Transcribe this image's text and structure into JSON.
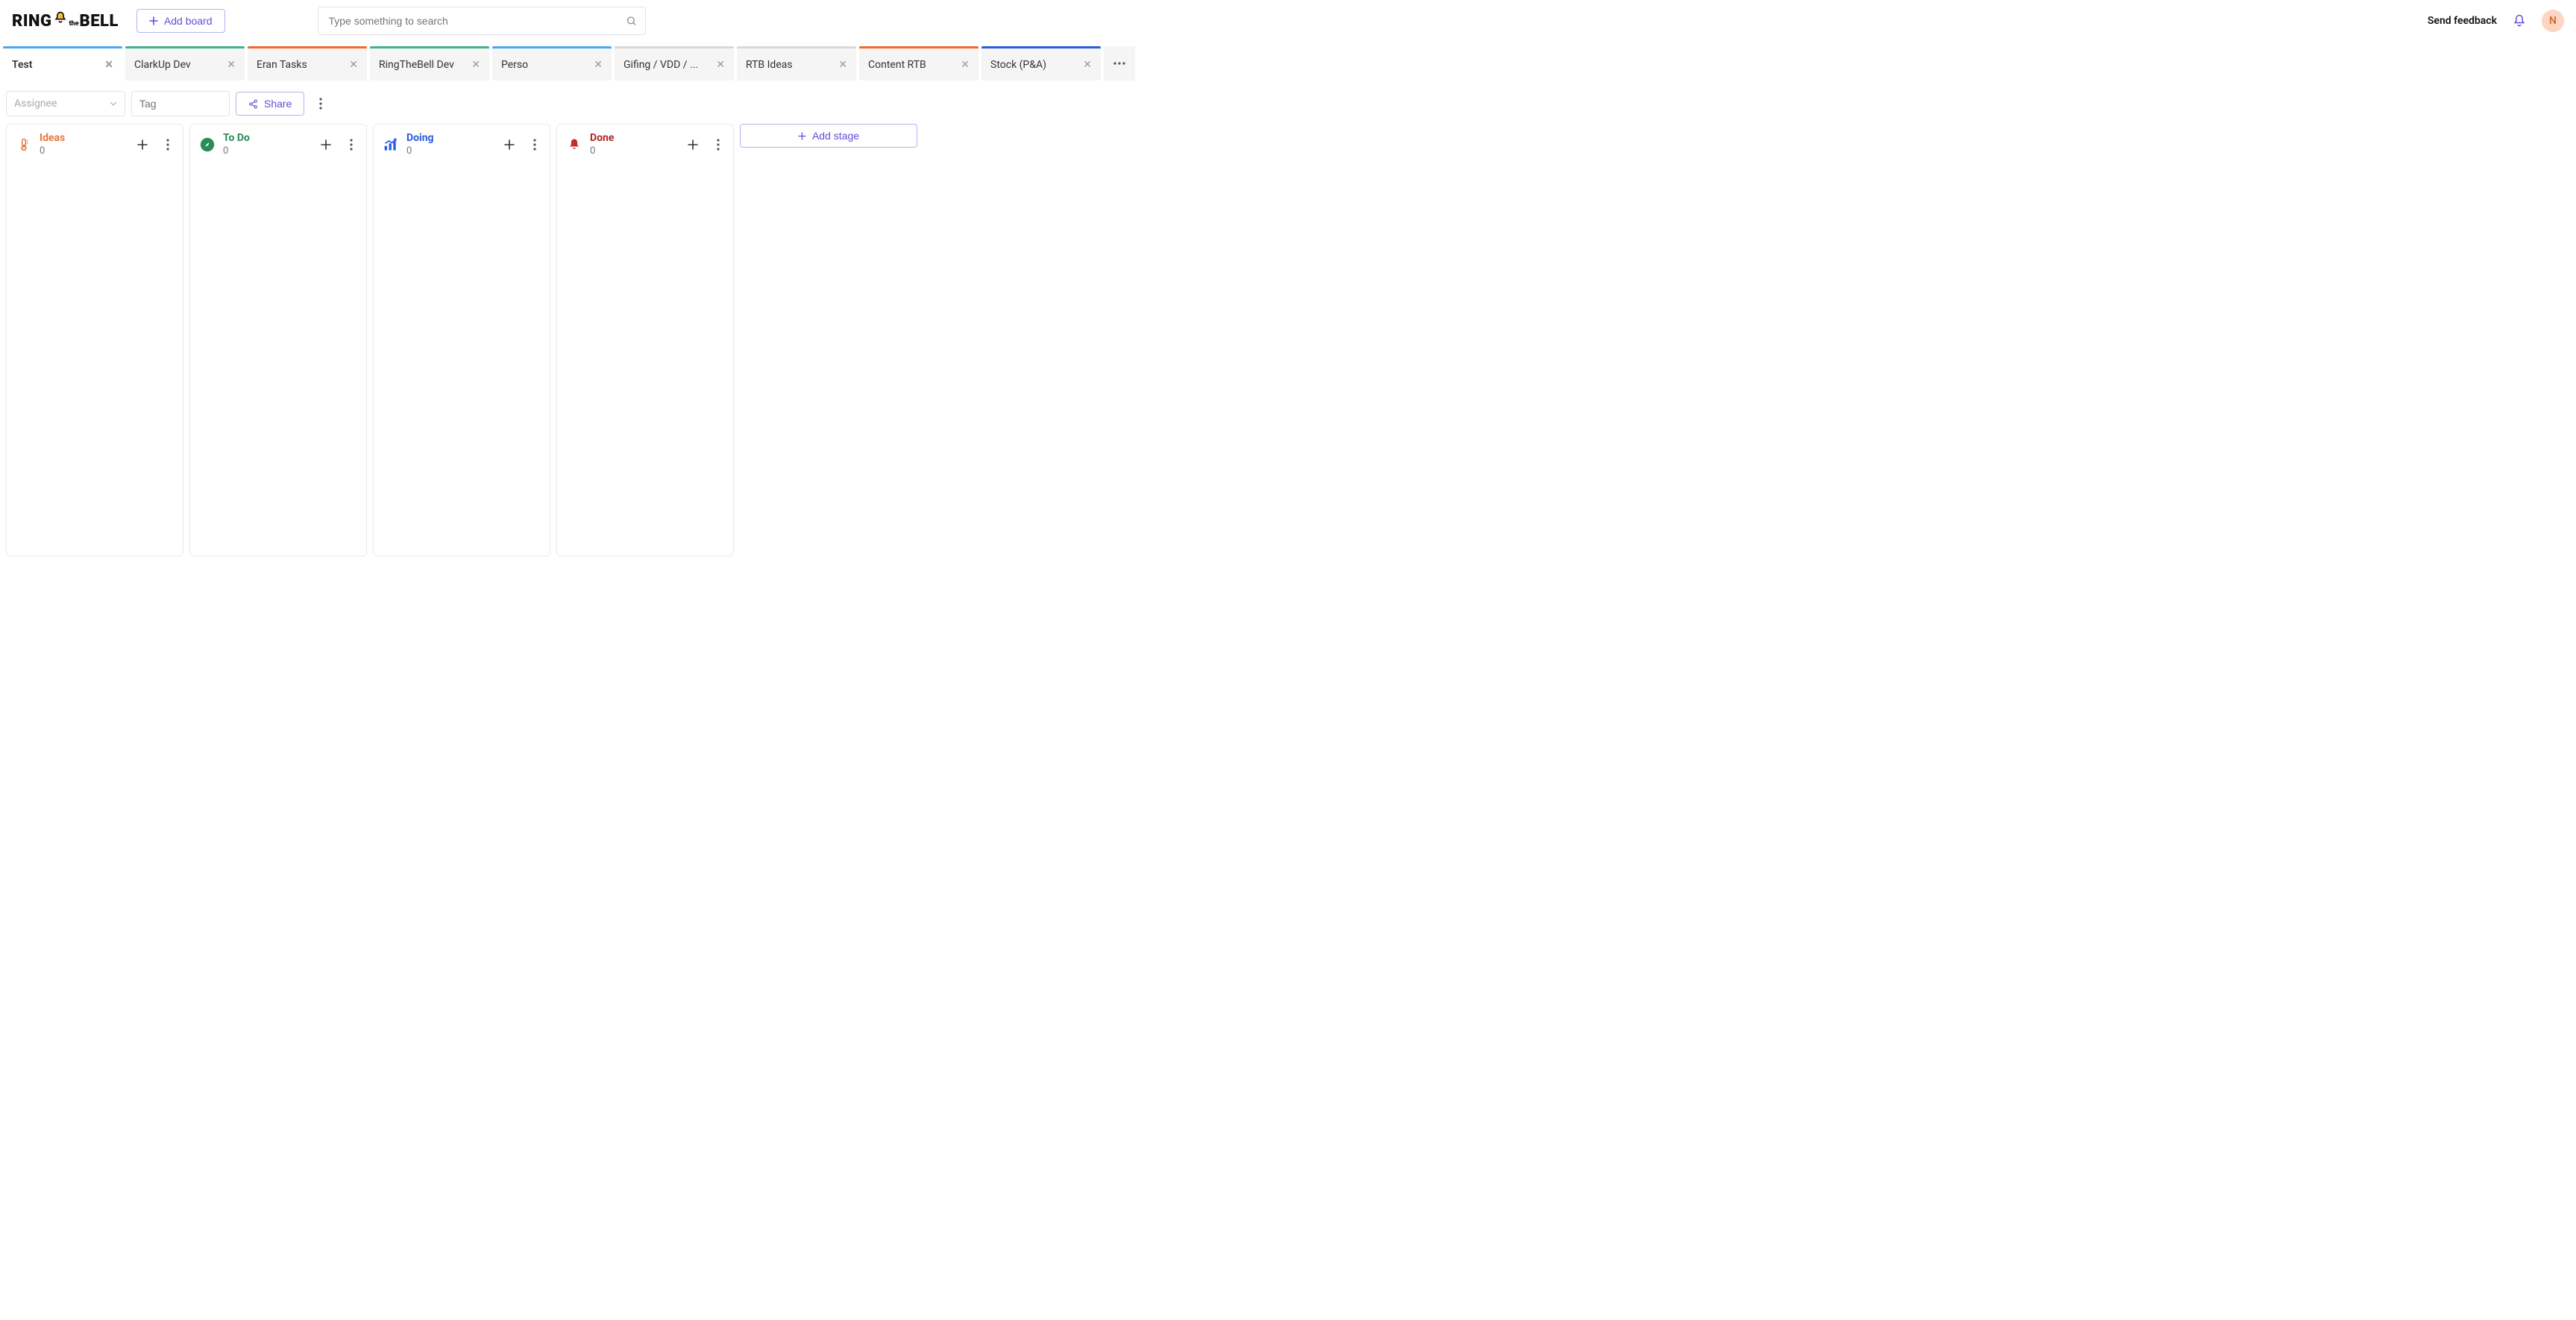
{
  "header": {
    "logo_part1": "RING",
    "logo_the": "the",
    "logo_part2": "BELL",
    "add_board_label": "Add board",
    "search_placeholder": "Type something to search",
    "feedback_label": "Send feedback",
    "avatar_initial": "N"
  },
  "tabs": [
    {
      "label": "Test",
      "color": "lightblue",
      "active": true
    },
    {
      "label": "ClarkUp Dev",
      "color": "green",
      "active": false
    },
    {
      "label": "Eran Tasks",
      "color": "orange",
      "active": false
    },
    {
      "label": "RingTheBell Dev",
      "color": "green",
      "active": false
    },
    {
      "label": "Perso",
      "color": "lightblue",
      "active": false
    },
    {
      "label": "Gifing / VDD / ...",
      "color": "gray",
      "active": false
    },
    {
      "label": "RTB Ideas",
      "color": "gray",
      "active": false
    },
    {
      "label": "Content RTB",
      "color": "orange",
      "active": false
    },
    {
      "label": "Stock (P&A)",
      "color": "blue",
      "active": false
    }
  ],
  "toolbar": {
    "assignee_placeholder": "Assignee",
    "tag_placeholder": "Tag",
    "share_label": "Share"
  },
  "columns": [
    {
      "id": "ideas",
      "title": "Ideas",
      "count": "0",
      "icon": "thermometer",
      "class": "col-ideas"
    },
    {
      "id": "todo",
      "title": "To Do",
      "count": "0",
      "icon": "compass",
      "class": "col-todo"
    },
    {
      "id": "doing",
      "title": "Doing",
      "count": "0",
      "icon": "chart-up",
      "class": "col-doing"
    },
    {
      "id": "done",
      "title": "Done",
      "count": "0",
      "icon": "bell-fill",
      "class": "col-done"
    }
  ],
  "add_stage_label": "Add stage"
}
